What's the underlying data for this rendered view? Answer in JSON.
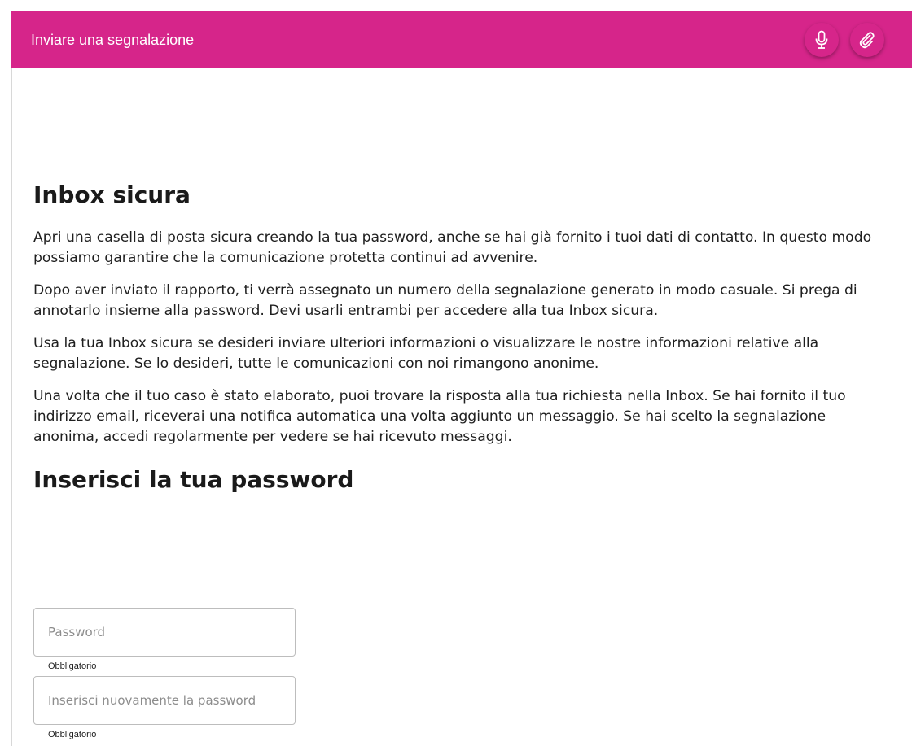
{
  "header": {
    "title": "Inviare una segnalazione",
    "mic_icon": "microphone-icon",
    "attach_icon": "paperclip-icon",
    "accent_color": "#d6258a"
  },
  "inbox": {
    "title": "Inbox sicura",
    "paragraphs": [
      "Apri una casella di posta sicura creando la tua password, anche se hai già fornito i tuoi dati di contatto. In questo modo possiamo garantire che la comunicazione protetta continui ad avvenire.",
      "Dopo aver inviato il rapporto, ti verrà assegnato un numero della segnalazione generato in modo casuale. Si prega di annotarlo insieme alla password. Devi usarli entrambi per accedere alla tua Inbox sicura.",
      "Usa la tua Inbox sicura se desideri inviare ulteriori informazioni o visualizzare le nostre informazioni relative alla segnalazione. Se lo desideri, tutte le comunicazioni con noi rimangono anonime.",
      "Una volta che il tuo caso è stato elaborato, puoi trovare la risposta alla tua richiesta nella Inbox. Se hai fornito il tuo indirizzo email, riceverai una notifica automatica una volta aggiunto un messaggio. Se hai scelto la segnalazione anonima, accedi regolarmente per vedere se hai ricevuto messaggi."
    ]
  },
  "password": {
    "title": "Inserisci la tua password",
    "field1": {
      "value": "",
      "placeholder": "Password",
      "hint": "Obbligatorio"
    },
    "field2": {
      "value": "",
      "placeholder": "Inserisci nuovamente la password",
      "hint": "Obbligatorio"
    }
  }
}
